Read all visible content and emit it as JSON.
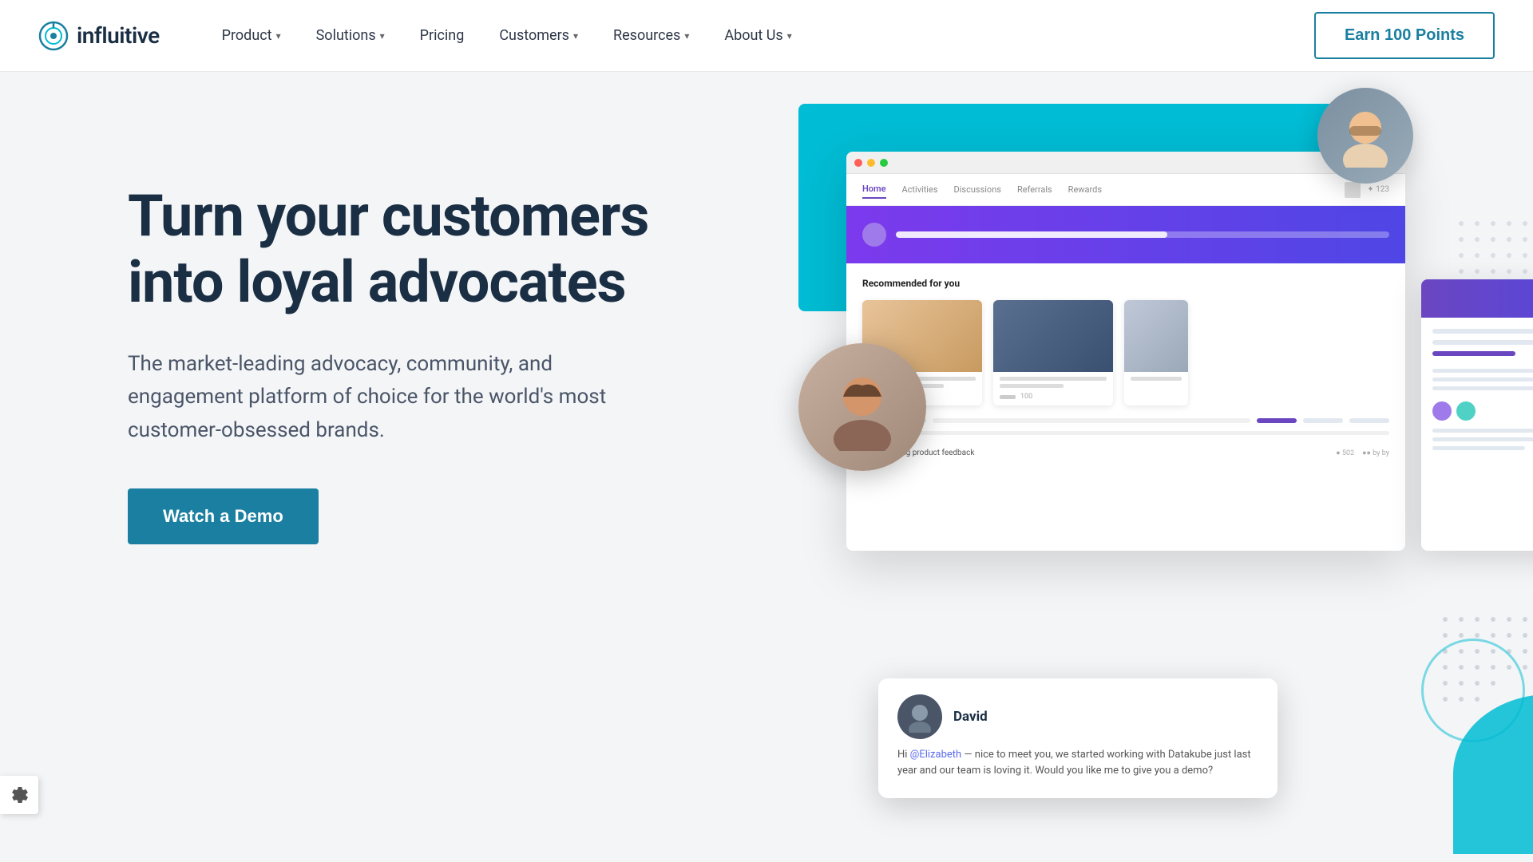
{
  "brand": {
    "name": "influitive",
    "logo_icon": "target-icon"
  },
  "navbar": {
    "links": [
      {
        "label": "Product",
        "has_dropdown": true
      },
      {
        "label": "Solutions",
        "has_dropdown": true
      },
      {
        "label": "Pricing",
        "has_dropdown": false
      },
      {
        "label": "Customers",
        "has_dropdown": true
      },
      {
        "label": "Resources",
        "has_dropdown": true
      },
      {
        "label": "About Us",
        "has_dropdown": true
      }
    ],
    "cta": "Earn 100 Points"
  },
  "hero": {
    "title": "Turn your customers into loyal advocates",
    "subtitle": "The market-leading advocacy, community, and engagement platform of choice for the world's most customer-obsessed brands.",
    "cta_button": "Watch a Demo"
  },
  "mockup": {
    "nav_items": [
      "Home",
      "Activities",
      "Discussions",
      "Referrals",
      "Rewards"
    ],
    "recommended_label": "Recommended for you",
    "chat": {
      "name": "David",
      "message": "Hi @Elizabeth — nice to meet you, we started working with Datakube just last year and our team is loving it. Would you like me to give you a demo?"
    }
  },
  "settings": {
    "icon": "gear-icon"
  }
}
